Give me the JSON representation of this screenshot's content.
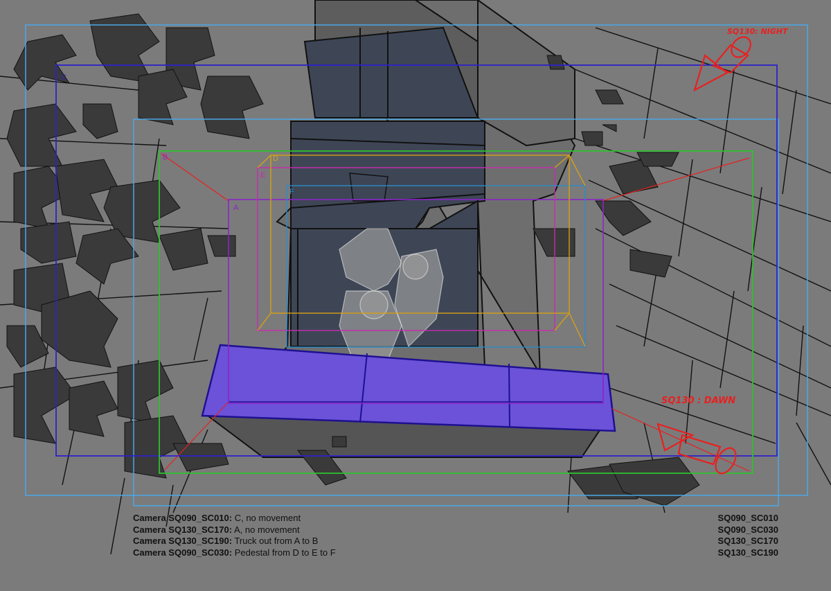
{
  "frames": [
    {
      "label": "C",
      "color": "#2e22c9"
    },
    {
      "label": "A",
      "color": "#8a24c9"
    },
    {
      "label": "B",
      "color": "#aa20b8"
    },
    {
      "label": "D",
      "color": "#d4a016"
    },
    {
      "label": "E",
      "color": "#c92ab0"
    },
    {
      "label": "F",
      "color": "#2a8ac9"
    }
  ],
  "annotations": {
    "top_right": "SQ130: NIGHT",
    "bottom_right": "SQ130 : DAWN"
  },
  "camera_notes": [
    {
      "camera": "Camera SQ090_SC010:",
      "description": " C, no movement"
    },
    {
      "camera": "Camera SQ130_SC170:",
      "description": " A, no movement"
    },
    {
      "camera": "Camera SQ130_SC190:",
      "description": " Truck out from A to B"
    },
    {
      "camera": "Camera SQ090_SC030:",
      "description": " Pedestal from D to E to F"
    }
  ],
  "shot_list": [
    "SQ090_SC010",
    "SQ090_SC030",
    "SQ130_SC170",
    "SQ130_SC190"
  ],
  "colors": {
    "background": "#7b7b7b",
    "ivy": "#3a3a3a",
    "window_dark": "#3e4656",
    "ledge": "#6b52d8",
    "frame_outer": "#4aa8e8",
    "frame_green": "#30c030",
    "arrow_red": "#e82020"
  }
}
